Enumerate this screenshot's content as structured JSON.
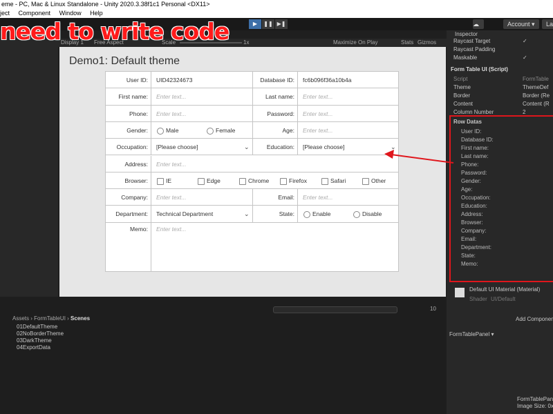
{
  "window": {
    "title": "eme - PC, Mac & Linux Standalone - Unity 2020.3.38f1c1 Personal <DX11>",
    "menu": [
      "ject",
      "Component",
      "Window",
      "Help"
    ]
  },
  "toolbar": {
    "play": "▶",
    "pause": "❚❚",
    "step": "▶❚",
    "account": "Account ▾",
    "layers": "Lay"
  },
  "overlay": {
    "banner_text": "need to write code"
  },
  "gameview": {
    "display": "Display 1",
    "aspect": "Free Aspect",
    "scale_label": "Scale",
    "scale_value": "1x",
    "maximize": "Maximize On Play",
    "stats": "Stats",
    "gizmos": "Gizmos"
  },
  "demo": {
    "title": "Demo1: Default theme",
    "rows": {
      "user_id_label": "User ID:",
      "user_id_value": "UID42324673",
      "db_id_label": "Database ID:",
      "db_id_value": "fc6b096f36a10b4a",
      "first_name_label": "First name:",
      "first_name_ph": "Enter text...",
      "last_name_label": "Last name:",
      "last_name_ph": "Enter text...",
      "phone_label": "Phone:",
      "phone_ph": "Enter text...",
      "password_label": "Password:",
      "password_ph": "Enter text...",
      "gender_label": "Gender:",
      "gender_male": "Male",
      "gender_female": "Female",
      "age_label": "Age:",
      "age_ph": "Enter text...",
      "occupation_label": "Occupation:",
      "occupation_value": "[Please choose]",
      "education_label": "Education:",
      "education_value": "[Please choose]",
      "address_label": "Address:",
      "address_ph": "Enter text...",
      "browser_label": "Browser:",
      "browsers": [
        "IE",
        "Edge",
        "Chrome",
        "Firefox",
        "Safari",
        "Other"
      ],
      "company_label": "Company:",
      "company_ph": "Enter text...",
      "email_label": "Email:",
      "email_ph": "Enter text...",
      "department_label": "Department:",
      "department_value": "Technical Department",
      "state_label": "State:",
      "state_enable": "Enable",
      "state_disable": "Disable",
      "memo_label": "Memo:",
      "memo_ph": "Enter text..."
    }
  },
  "inspector": {
    "tab": "Inspector",
    "props_top": [
      "Raycast Target",
      "Raycast Padding",
      "Maskable"
    ],
    "component_title": "Form Table UI (Script)",
    "fields": [
      {
        "label": "Script",
        "value": "FormTable"
      },
      {
        "label": "Theme",
        "value": "ThemeDef"
      },
      {
        "label": "Border",
        "value": "Border (Re"
      },
      {
        "label": "Content",
        "value": "Content (R"
      },
      {
        "label": "Column Number",
        "value": "2"
      }
    ],
    "row_datas_title": "Row Datas",
    "row_datas": [
      "User ID:",
      "Database ID:",
      "First name:",
      "Last name:",
      "Phone:",
      "Password:",
      "Gender:",
      "Age:",
      "Occupation:",
      "Education:",
      "Address:",
      "Browser:",
      "Company:",
      "Email:",
      "Department:",
      "State:",
      "Memo:"
    ],
    "material_title": "Default UI Material (Material)",
    "shader_label": "Shader",
    "shader_value": "UI/Default",
    "add_component": "Add Component",
    "preview_title": "FormTablePanel ▾",
    "preview_name": "FormTablePan",
    "image_size": "Image Size: 0x"
  },
  "project": {
    "breadcrumb": [
      "Assets",
      "FormTableUI",
      "Scenes"
    ],
    "items": [
      "01DefaultTheme",
      "02NoBorderTheme",
      "03DarkTheme",
      "04ExportData"
    ],
    "count": "10"
  },
  "colors": {
    "highlight": "#e0161c",
    "accent": "#3d6fa8"
  }
}
